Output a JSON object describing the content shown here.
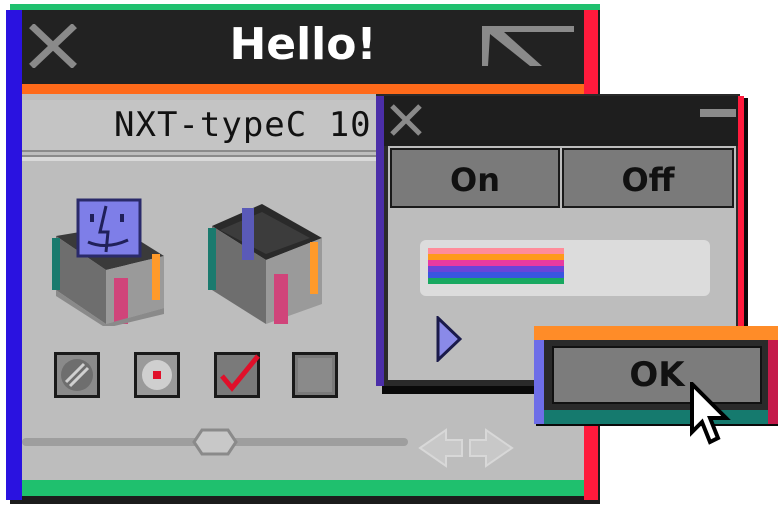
{
  "main_window": {
    "title": "Hello!",
    "subtitle": "NXT-typeC 10"
  },
  "dialog": {
    "segments": [
      {
        "label": "On"
      },
      {
        "label": "Off"
      }
    ],
    "progress_fraction": 0.47
  },
  "ok_button": {
    "label": "OK"
  },
  "icons": [
    "close-icon",
    "zoom-icon",
    "trash-bin-finder-icon",
    "trash-bin-empty-icon",
    "radio-off-icon",
    "radio-on-icon",
    "checkbox-checked-icon",
    "checkbox-empty-icon",
    "slider-thumb-icon",
    "scroll-arrows-icon",
    "minimize-icon",
    "play-triangle-icon",
    "mouse-cursor-icon"
  ],
  "colors": {
    "accent_green": "#1fc06e",
    "accent_blue": "#2a12e0",
    "accent_red": "#ff1a3c",
    "accent_orange": "#ff6a1a",
    "rainbow": [
      "#ff8c9a",
      "#ff9a1a",
      "#e83aa0",
      "#6a44d8",
      "#3a55e0",
      "#18a860"
    ]
  }
}
